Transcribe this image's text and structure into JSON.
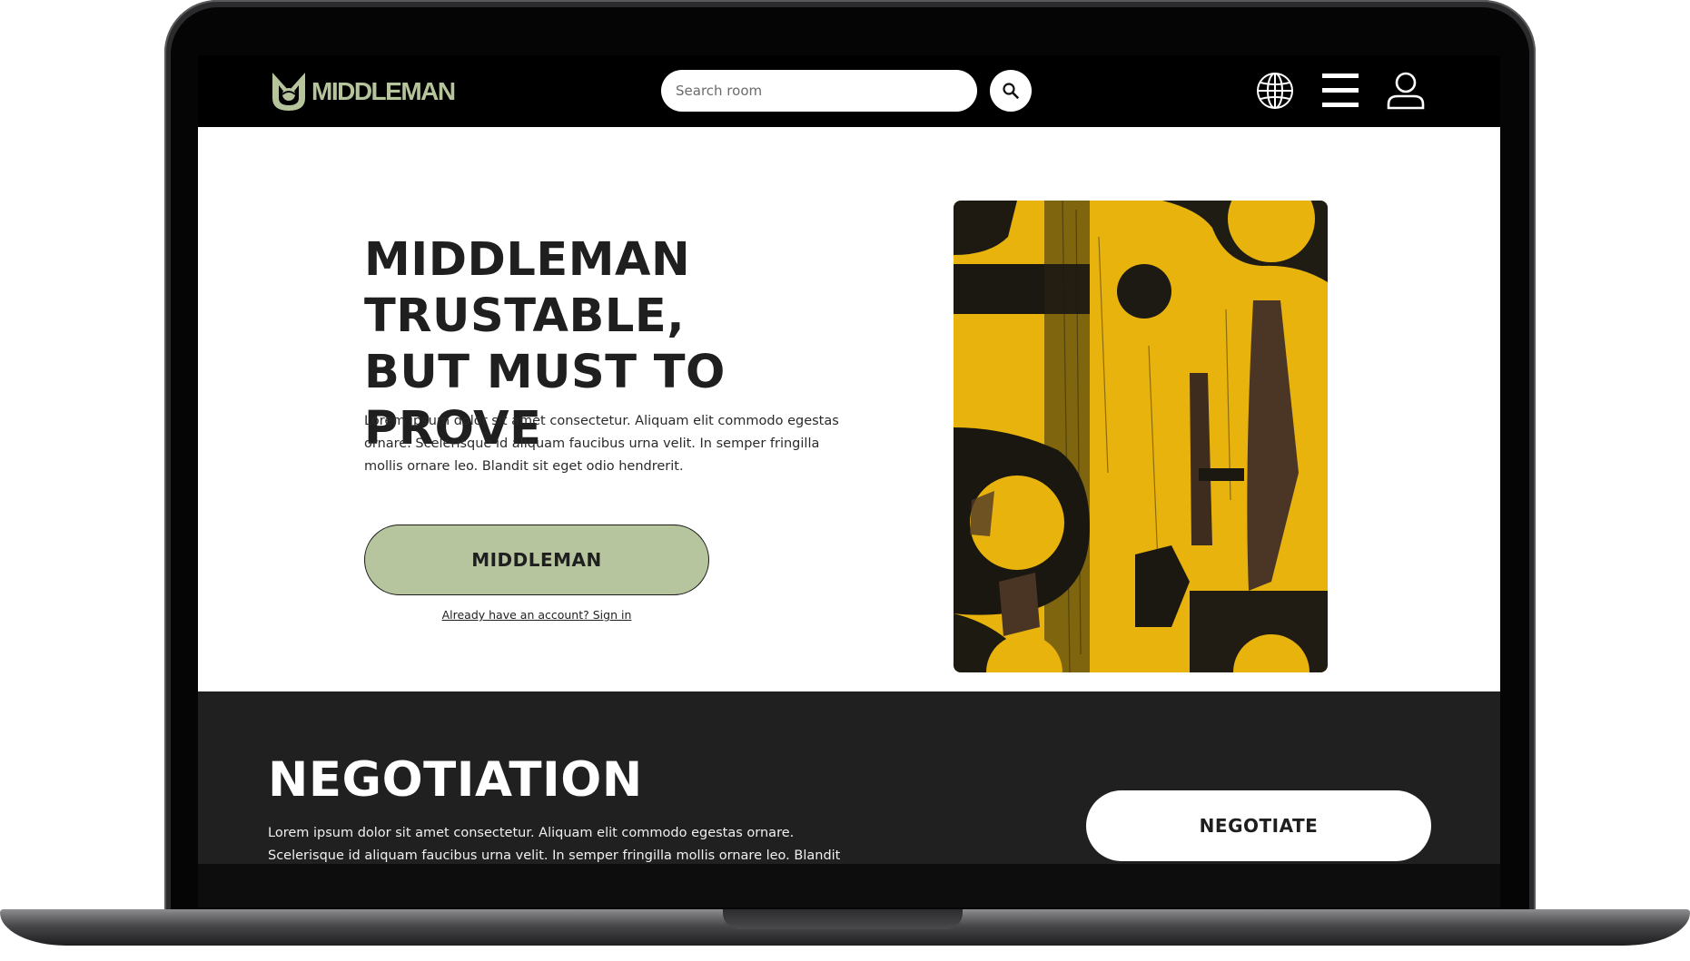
{
  "nav": {
    "logo_text": "MIDDLEMAN",
    "search_placeholder": "Search room",
    "icons": [
      "search-icon",
      "globe-icon",
      "hamburger-menu-icon",
      "user-icon"
    ]
  },
  "hero": {
    "title": "MIDDLEMAN\nTRUSTABLE,\nBUT MUST TO PROVE",
    "description": "Lorem ipsum dolor sit amet consectetur. Aliquam elit commodo egestas ornare. Scelerisque id aliquam faucibus urna velit. In semper fringilla mollis ornare leo. Blandit sit eget odio hendrerit.",
    "cta_label": "MIDDLEMAN",
    "signin_text": "Already have an account? Sign in"
  },
  "negotiation": {
    "title": "NEGOTIATION",
    "description": "Lorem ipsum dolor sit amet consectetur. Aliquam elit commodo egestas ornare. Scelerisque id aliquam faucibus urna velit. In semper fringilla mollis ornare leo. Blandit sit eget odio",
    "cta_label": "NEGOTIATE"
  },
  "colors": {
    "accent_green": "#b6c59e",
    "nav_bg": "#000000",
    "section_dark": "#202020",
    "art_yellow": "#e8b20c"
  }
}
